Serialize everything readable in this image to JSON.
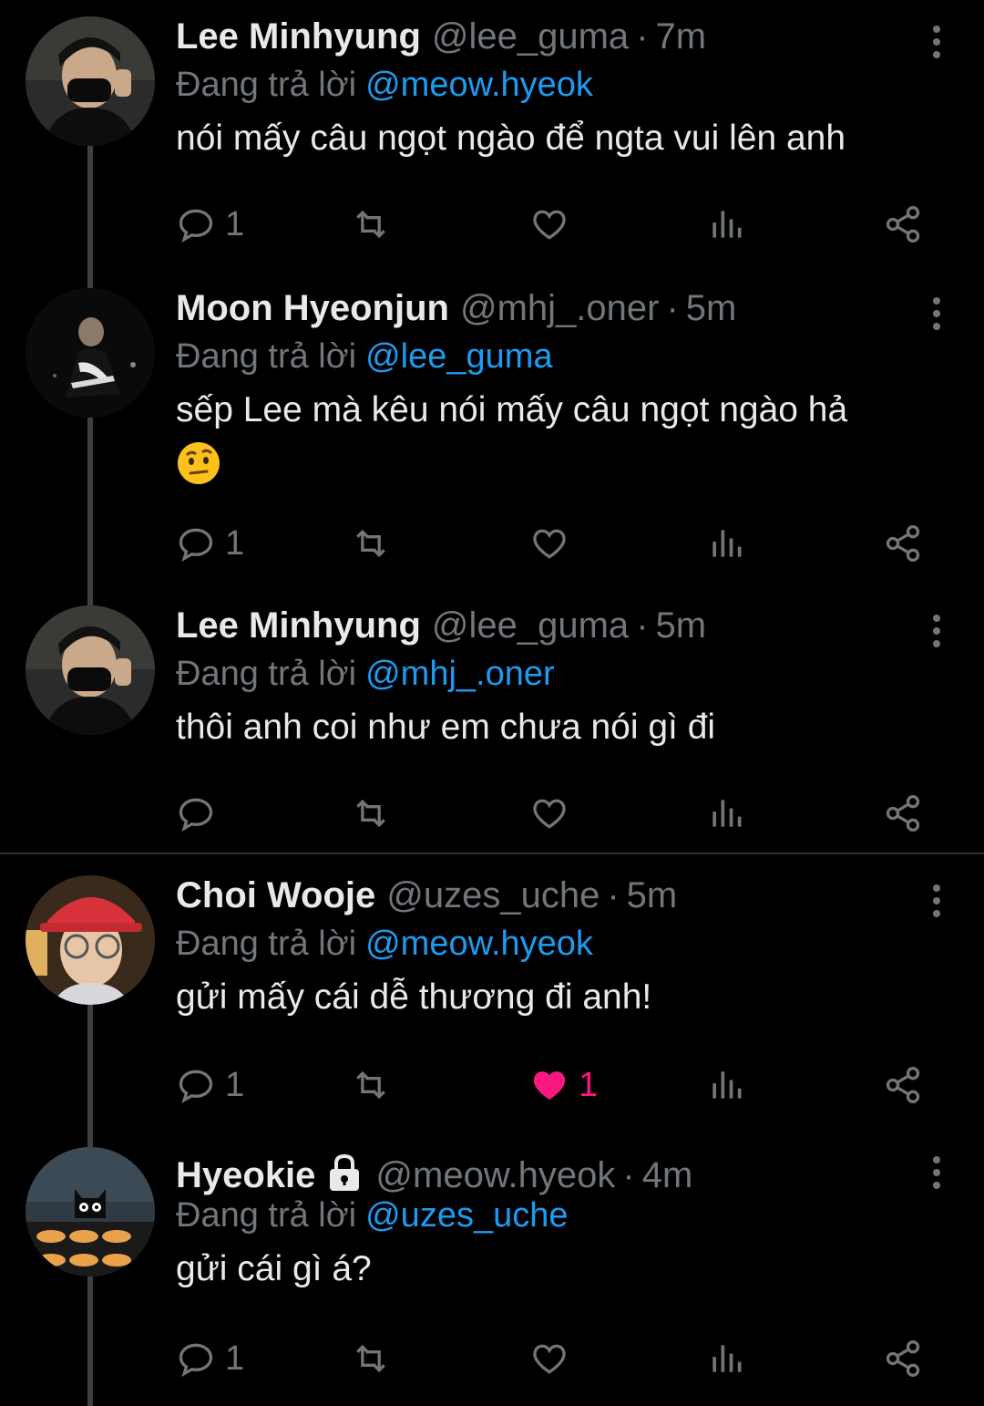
{
  "tweets": [
    {
      "name": "Lee Minhyung",
      "handle": "@lee_guma",
      "time": "7m",
      "replying_label": "Đang trả lời",
      "replying_to": "@meow.hyeok",
      "text": "nói mấy câu ngọt ngào để ngta vui lên anh",
      "reply_count": "1",
      "like_count": "",
      "liked": false,
      "locked": false,
      "avatar": "avatar-lee-minhyung"
    },
    {
      "name": "Moon Hyeonjun",
      "handle": "@mhj_.oner",
      "time": "5m",
      "replying_label": "Đang trả lời",
      "replying_to": "@lee_guma",
      "text": "sếp Lee mà kêu nói mấy câu ngọt ngào hả",
      "emoji": "face-with-raised-eyebrow",
      "reply_count": "1",
      "like_count": "",
      "liked": false,
      "locked": false,
      "avatar": "avatar-moon-hyeonjun"
    },
    {
      "name": "Lee Minhyung",
      "handle": "@lee_guma",
      "time": "5m",
      "replying_label": "Đang trả lời",
      "replying_to": "@mhj_.oner",
      "text": "thôi anh coi như em chưa nói gì đi",
      "reply_count": "",
      "like_count": "",
      "liked": false,
      "locked": false,
      "avatar": "avatar-lee-minhyung"
    },
    {
      "name": "Choi Wooje",
      "handle": "@uzes_uche",
      "time": "5m",
      "replying_label": "Đang trả lời",
      "replying_to": "@meow.hyeok",
      "text": "gửi mấy cái dễ thương đi anh!",
      "reply_count": "1",
      "like_count": "1",
      "liked": true,
      "locked": false,
      "avatar": "avatar-choi-wooje"
    },
    {
      "name": "Hyeokie",
      "handle": "@meow.hyeok",
      "time": "4m",
      "replying_label": "Đang trả lời",
      "replying_to": "@uzes_uche",
      "text": "gửi cái gì á?",
      "reply_count": "1",
      "like_count": "",
      "liked": false,
      "locked": true,
      "avatar": "avatar-hyeokie"
    }
  ],
  "icons": {
    "reply": "reply-icon",
    "retweet": "retweet-icon",
    "like": "heart-icon",
    "views": "views-icon",
    "share": "share-icon",
    "more": "more-vertical-icon",
    "lock": "lock-icon"
  },
  "colors": {
    "background": "#000000",
    "text": "#e7e9ea",
    "muted": "#71767b",
    "link": "#1d9bf0",
    "like": "#f91880",
    "divider": "#2f3336"
  }
}
